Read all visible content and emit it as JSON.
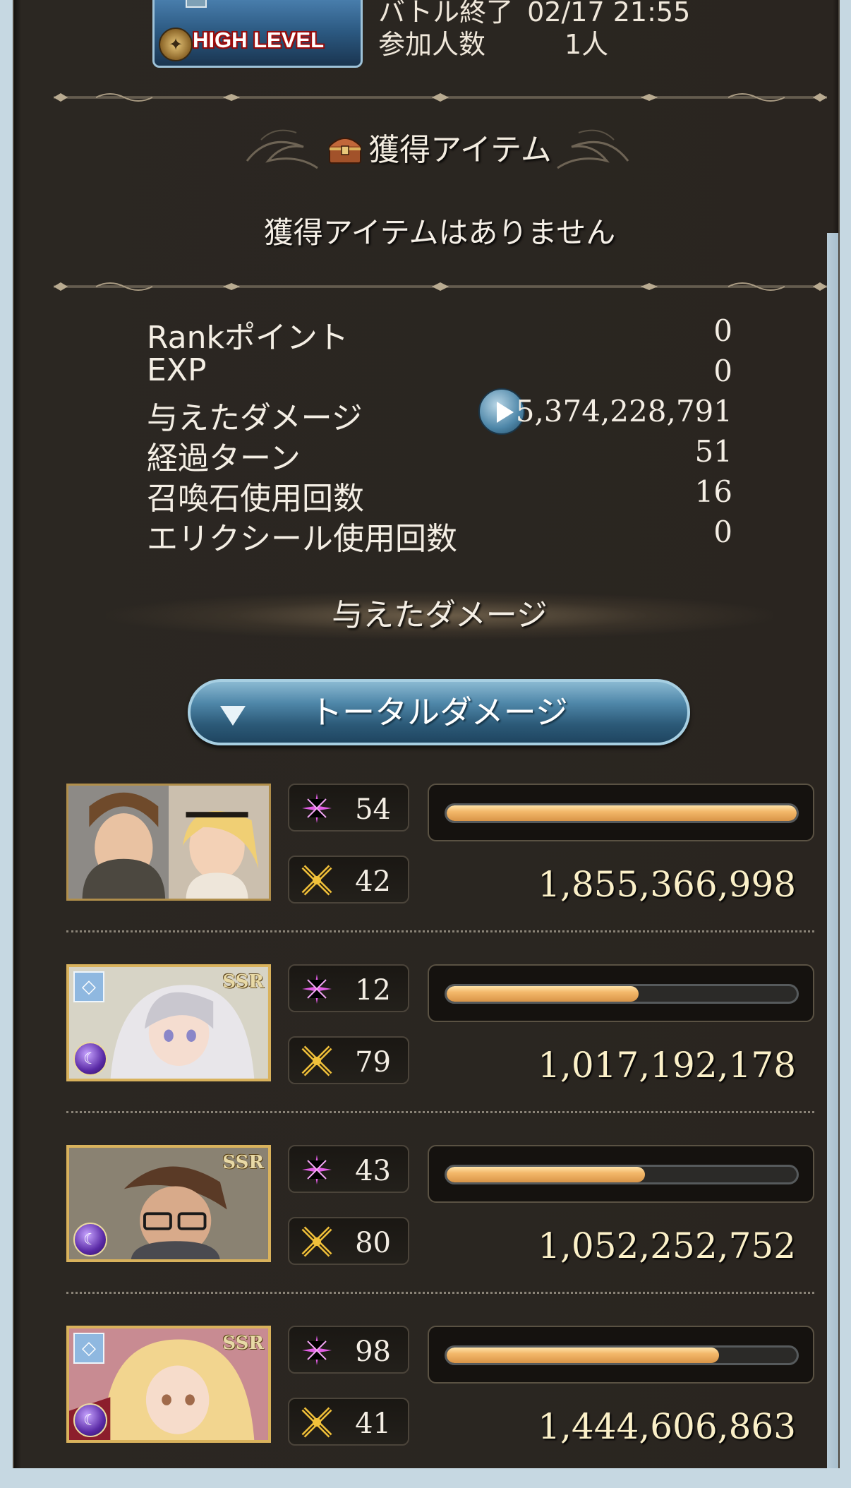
{
  "quest": {
    "badge_text": "HIGH LEVEL",
    "battle_end_label": "バトル終了",
    "battle_end_value": "02/17 21:55",
    "participants_label": "参加人数",
    "participants_value": "1人"
  },
  "items_section": {
    "title": "獲得アイテム",
    "empty_text": "獲得アイテムはありません"
  },
  "stats": [
    {
      "label": "Rankポイント",
      "value": "0"
    },
    {
      "label": "EXP",
      "value": "0"
    },
    {
      "label": "与えたダメージ",
      "value": "5,374,228,791"
    },
    {
      "label": "経過ターン",
      "value": "51"
    },
    {
      "label": "召喚石使用回数",
      "value": "16"
    },
    {
      "label": "エリクシール使用回数",
      "value": "0"
    }
  ],
  "damage_section": {
    "heading": "与えたダメージ",
    "dropdown_label": "トータルダメージ"
  },
  "characters": [
    {
      "skill_count": "54",
      "attack_count": "42",
      "damage": "1,855,366,998",
      "bar_fraction": 1.0,
      "rarity": "",
      "element": ""
    },
    {
      "skill_count": "12",
      "attack_count": "79",
      "damage": "1,017,192,178",
      "bar_fraction": 0.548,
      "rarity": "SSR",
      "element": "dark"
    },
    {
      "skill_count": "43",
      "attack_count": "80",
      "damage": "1,052,252,752",
      "bar_fraction": 0.567,
      "rarity": "SSR",
      "element": "dark"
    },
    {
      "skill_count": "98",
      "attack_count": "41",
      "damage": "1,444,606,863",
      "bar_fraction": 0.778,
      "rarity": "SSR",
      "element": "dark"
    }
  ],
  "colors": {
    "panel_bg": "#2a2520",
    "bar_fill": "#f3b86a",
    "damage_text": "#fbf0c8",
    "dropdown": "#4f87a9"
  }
}
